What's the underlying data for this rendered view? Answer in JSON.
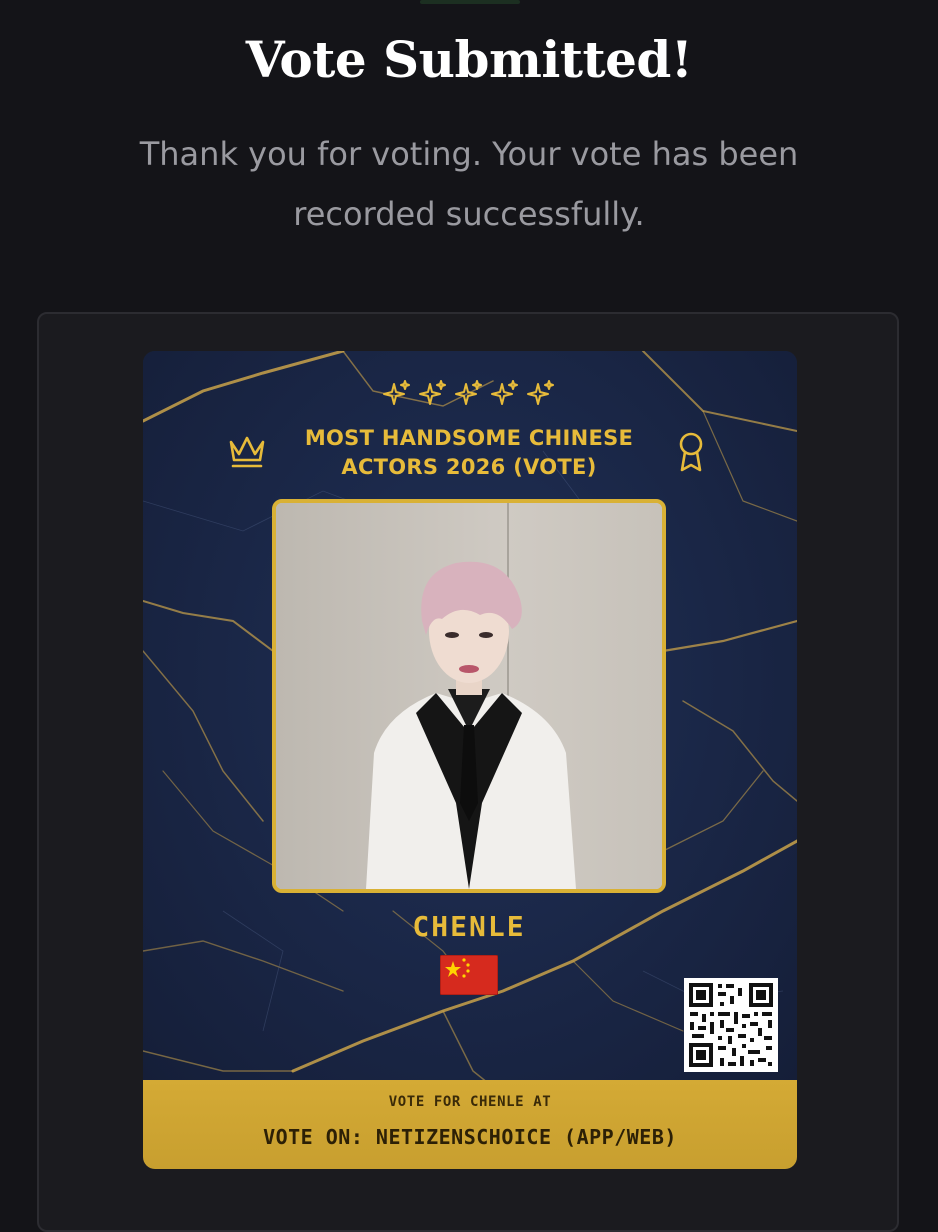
{
  "header": {
    "title": "Vote Submitted!",
    "message": "Thank you for voting. Your vote has been recorded successfully."
  },
  "card": {
    "title": "MOST HANDSOME CHINESE ACTORS 2026 (VOTE)",
    "nominee_name": "CHENLE",
    "footer_line1": "VOTE FOR CHENLE AT",
    "footer_line2": "VOTE ON: NETIZENSCHOICE (APP/WEB)",
    "icons": [
      "sparkle-icon",
      "crown-icon",
      "award-ribbon-icon",
      "china-flag-icon",
      "qr-code"
    ]
  },
  "colors": {
    "background": "#141418",
    "panel": "#1b1b1f",
    "card_marble": "#1a2542",
    "gold": "#e7bb3a",
    "footer_gold": "#d4aa35"
  }
}
